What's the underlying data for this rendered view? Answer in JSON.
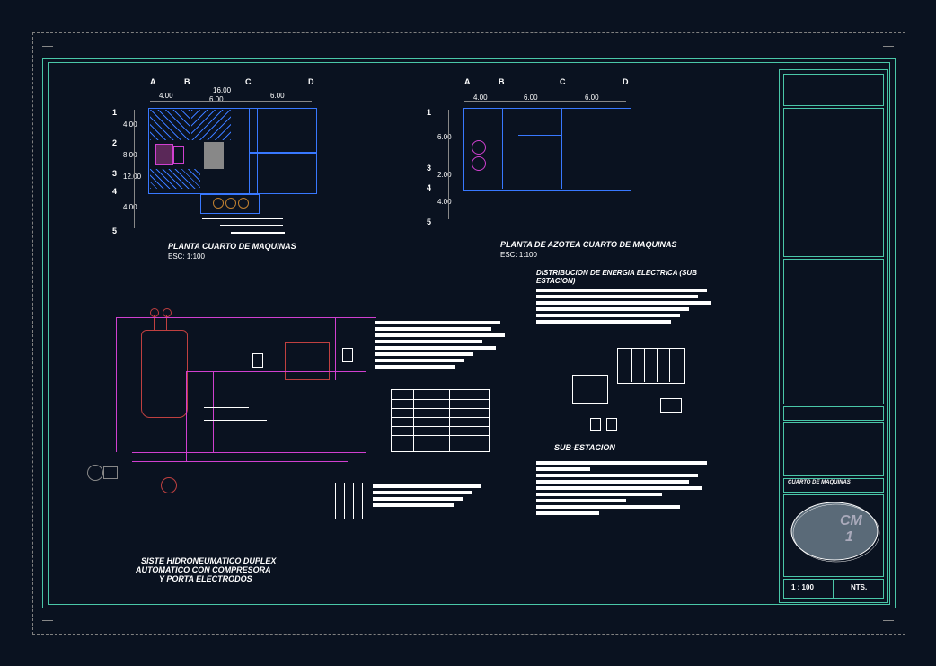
{
  "drawing": {
    "plan1": {
      "title": "PLANTA CUARTO DE MAQUINAS",
      "scale": "ESC: 1:100",
      "gridcols": [
        "A",
        "B",
        "C",
        "D"
      ],
      "gridrows": [
        "1",
        "2",
        "3",
        "4",
        "5"
      ],
      "dims_h": [
        "4.00",
        "16.00",
        "6.00"
      ],
      "dim_h_inner": "6.00",
      "dims_v": [
        "4.00",
        "8.00",
        "12.00",
        "4.00"
      ]
    },
    "plan2": {
      "title": "PLANTA DE AZOTEA CUARTO DE MAQUINAS",
      "scale": "ESC: 1:100",
      "gridcols": [
        "A",
        "B",
        "C",
        "D"
      ],
      "gridrows": [
        "1",
        "3",
        "4",
        "5"
      ],
      "dims_h": [
        "4.00",
        "6.00",
        "6.00"
      ],
      "dims_v": [
        "6.00",
        "2.00",
        "4.00"
      ]
    },
    "schematic": {
      "title1": "SISTE HIDRONEUMATICO DUPLEX",
      "title2": "AUTOMATICO CON COMPRESORA",
      "title3": "Y PORTA ELECTRODOS"
    },
    "electrical": {
      "title": "DISTRIBUCION DE ENERGIA ELECTRICA (SUB ESTACION)",
      "sub": "SUB-ESTACION"
    },
    "titleblock": {
      "sheet_label": "CM",
      "sheet_num": "1",
      "scale": "1 : 100",
      "nts": "NTS.",
      "project": "CUARTO DE MAQUINAS"
    }
  }
}
